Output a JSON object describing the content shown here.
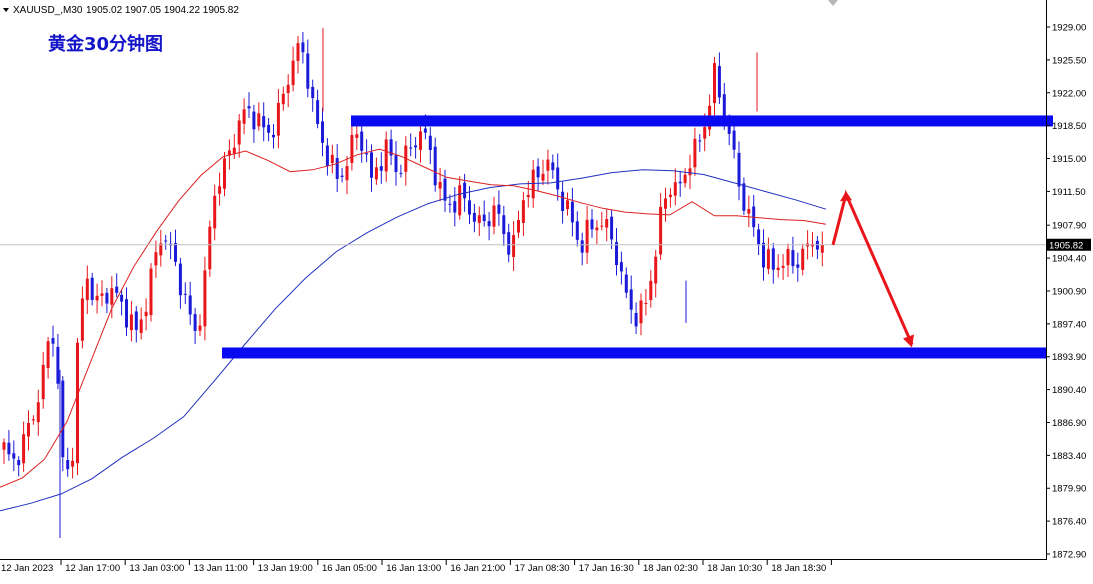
{
  "header": {
    "symbol": "XAUUSD_,M30",
    "ohlc": "1905.02 1907.05 1904.22 1905.82"
  },
  "chart_title": "黄金30分钟图",
  "current_price_label": "1905.82",
  "colors": {
    "bull": "#e8151b",
    "bear": "#1a1ad8",
    "ma_fast": "#dd2020",
    "ma_slow": "#2030c0",
    "level_band": "#0a0af0",
    "arrow": "#e8151b",
    "title": "#1414c8"
  },
  "chart_data": {
    "type": "candlestick",
    "ylim": [
      1872.9,
      1929.0
    ],
    "y_ticks": [
      "1929.00",
      "1925.50",
      "1922.00",
      "1918.50",
      "1915.00",
      "1911.50",
      "1907.90",
      "1904.40",
      "1900.90",
      "1897.40",
      "1893.90",
      "1890.40",
      "1886.90",
      "1883.40",
      "1879.90",
      "1876.40",
      "1872.90"
    ],
    "x_ticks": [
      "12 Jan 2023",
      "12 Jan 17:00",
      "13 Jan 03:00",
      "13 Jan 11:00",
      "13 Jan 19:00",
      "16 Jan 05:00",
      "16 Jan 13:00",
      "16 Jan 21:00",
      "17 Jan 08:30",
      "17 Jan 16:30",
      "18 Jan 02:30",
      "18 Jan 10:30",
      "18 Jan 18:30"
    ],
    "resistance_level": 1919.0,
    "support_level": 1894.3,
    "current_price": 1905.82,
    "projection": [
      1905.8,
      1911.2,
      1895.2
    ],
    "close_path": [
      1884.2,
      1882.5,
      1884.0,
      1886.5,
      1889.0,
      1894.0,
      1897.0,
      1883.0,
      1880.5,
      1898.0,
      1902.5,
      1899.5,
      1900.3,
      1901.2,
      1899.3,
      1898.1,
      1896.2,
      1899.8,
      1904.0,
      1907.4,
      1905.0,
      1902.2,
      1899.0,
      1896.0,
      1901.5,
      1910.8,
      1913.2,
      1915.5,
      1918.5,
      1920.2,
      1919.5,
      1918.2,
      1917.6,
      1920.2,
      1923.5,
      1926.8,
      1925.8,
      1920.5,
      1916.8,
      1915.0,
      1912.5,
      1914.5,
      1917.6,
      1916.8,
      1912.5,
      1914.8,
      1916.2,
      1913.6,
      1915.0,
      1916.6,
      1918.0,
      1916.0,
      1912.0,
      1910.0,
      1910.4,
      1911.2,
      1909.0,
      1907.9,
      1908.8,
      1909.6,
      1906.5,
      1905.4,
      1910.5,
      1912.2,
      1913.2,
      1915.0,
      1912.4,
      1910.4,
      1908.4,
      1905.5,
      1907.4,
      1908.2,
      1907.9,
      1906.2,
      1901.9,
      1899.2,
      1897.8,
      1900.2,
      1904.8,
      1910.8,
      1912.2,
      1911.8,
      1914.8,
      1916.2,
      1918.8,
      1924.0,
      1921.0,
      1917.0,
      1912.5,
      1909.0,
      1907.2,
      1904.2,
      1903.6,
      1903.8,
      1904.2,
      1904.0,
      1905.2,
      1906.5,
      1905.82
    ],
    "ma_fast_values": [
      1880.0,
      1881.0,
      1883.0,
      1887.0,
      1893.0,
      1899.0,
      1903.5,
      1907.2,
      1910.5,
      1913.2,
      1915.2,
      1915.8,
      1914.8,
      1913.6,
      1913.8,
      1914.4,
      1915.4,
      1916.0,
      1915.2,
      1914.1,
      1913.0,
      1912.6,
      1912.2,
      1912.1,
      1911.6,
      1911.0,
      1910.3,
      1909.7,
      1909.3,
      1909.1,
      1909.0,
      1910.4,
      1908.9,
      1908.9,
      1908.7,
      1908.5,
      1908.4,
      1908.0
    ],
    "ma_slow_values": [
      1877.5,
      1878.3,
      1879.3,
      1880.9,
      1883.2,
      1885.2,
      1887.5,
      1891.3,
      1895.2,
      1899.0,
      1902.3,
      1905.1,
      1907.1,
      1908.8,
      1910.2,
      1911.2,
      1911.9,
      1912.3,
      1912.4,
      1912.9,
      1913.5,
      1913.8,
      1913.7,
      1913.3,
      1912.4,
      1911.5,
      1910.6,
      1909.6
    ]
  }
}
